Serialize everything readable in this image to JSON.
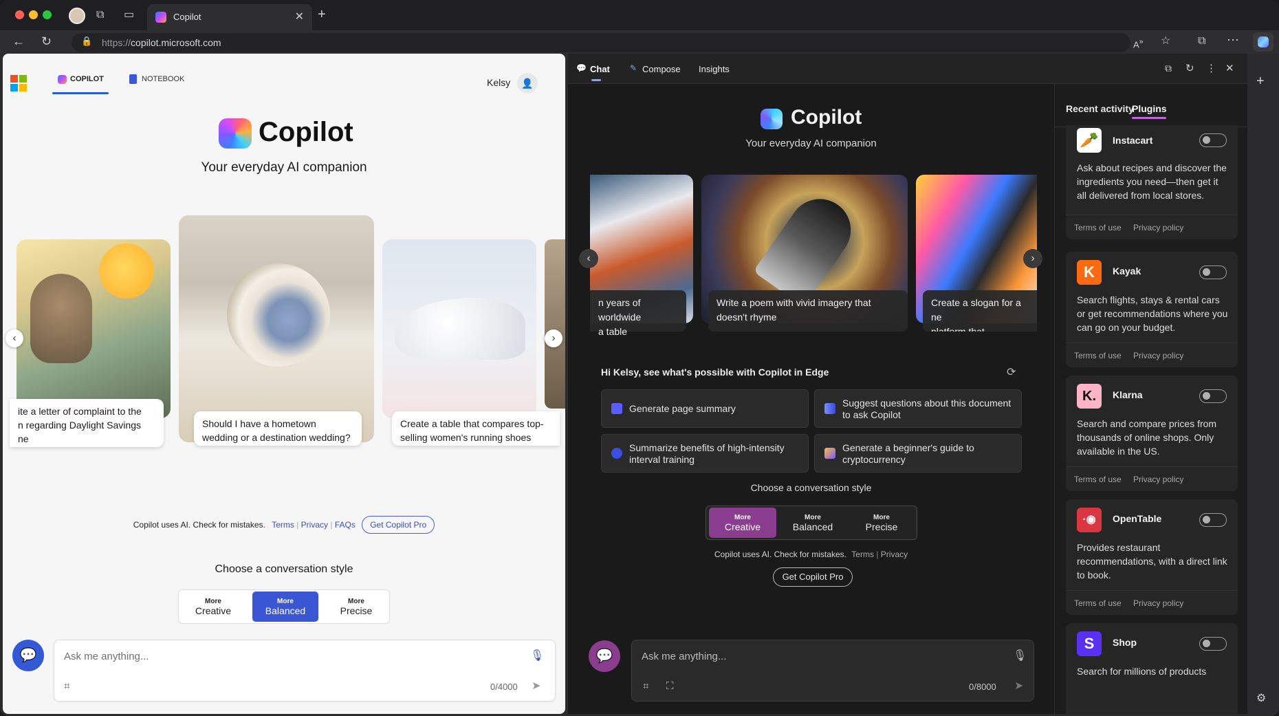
{
  "browser": {
    "tab_title": "Copilot",
    "url_prefix": "https://",
    "url_domain": "copilot.microsoft.com"
  },
  "left": {
    "nav": {
      "copilot": "COPILOT",
      "notebook": "NOTEBOOK",
      "user": "Kelsy"
    },
    "title": "Copilot",
    "subtitle": "Your everyday AI companion",
    "cards": [
      {
        "caption": "ite a letter of complaint to the\nn regarding Daylight Savings\nne"
      },
      {
        "caption": "Should I have a hometown wedding or a destination wedding?"
      },
      {
        "caption": "Create a table that compares top-selling women's running shoes"
      }
    ],
    "disclaimer": "Copilot uses AI. Check for mistakes.",
    "links": [
      "Terms",
      "Privacy",
      "FAQs"
    ],
    "pro_button": "Get Copilot Pro",
    "style_heading": "Choose a conversation style",
    "styles": [
      {
        "small": "More",
        "label": "Creative"
      },
      {
        "small": "More",
        "label": "Balanced"
      },
      {
        "small": "More",
        "label": "Precise"
      }
    ],
    "input_placeholder": "Ask me anything...",
    "counter": "0/4000"
  },
  "right": {
    "tabs": [
      "Chat",
      "Compose",
      "Insights"
    ],
    "title": "Copilot",
    "subtitle": "Your everyday AI companion",
    "cards": [
      {
        "caption": "n years of worldwide\n a table"
      },
      {
        "caption": "Write a poem with vivid imagery that doesn't rhyme"
      },
      {
        "caption": "Create a slogan for a ne\nplatform that specializes"
      }
    ],
    "greeting": "Hi Kelsy, see what's possible with Copilot in Edge",
    "suggestions": [
      "Generate page summary",
      "Suggest questions about this document to ask Copilot",
      "Summarize benefits of high-intensity interval training",
      "Generate a beginner's guide to cryptocurrency"
    ],
    "style_heading": "Choose a conversation style",
    "styles": [
      {
        "small": "More",
        "label": "Creative"
      },
      {
        "small": "More",
        "label": "Balanced"
      },
      {
        "small": "More",
        "label": "Precise"
      }
    ],
    "disclaimer": "Copilot uses AI. Check for mistakes.",
    "links": [
      "Terms",
      "Privacy"
    ],
    "pro_button": "Get Copilot Pro",
    "input_placeholder": "Ask me anything...",
    "counter": "0/8000",
    "side_tabs": [
      "Recent activity",
      "Plugins"
    ],
    "plugins": [
      {
        "name": "Instacart",
        "desc": "Ask about recipes and discover the ingredients you need—then get it all delivered from local stores.",
        "terms": "Terms of use",
        "privacy": "Privacy policy",
        "color": "#ffffff",
        "logo": "🥕"
      },
      {
        "name": "Kayak",
        "desc": "Search flights, stays & rental cars or get recommendations where you can go on your budget.",
        "terms": "Terms of use",
        "privacy": "Privacy policy",
        "color": "#ff690f",
        "logo": "K"
      },
      {
        "name": "Klarna",
        "desc": "Search and compare prices from thousands of online shops. Only available in the US.",
        "terms": "Terms of use",
        "privacy": "Privacy policy",
        "color": "#ffb3c7",
        "logo": "K."
      },
      {
        "name": "OpenTable",
        "desc": "Provides restaurant recommendations, with a direct link to book.",
        "terms": "Terms of use",
        "privacy": "Privacy policy",
        "color": "#da3743",
        "logo": "·◉"
      },
      {
        "name": "Shop",
        "desc": "Search for millions of products",
        "color": "#5a31f4",
        "logo": "S"
      }
    ]
  }
}
